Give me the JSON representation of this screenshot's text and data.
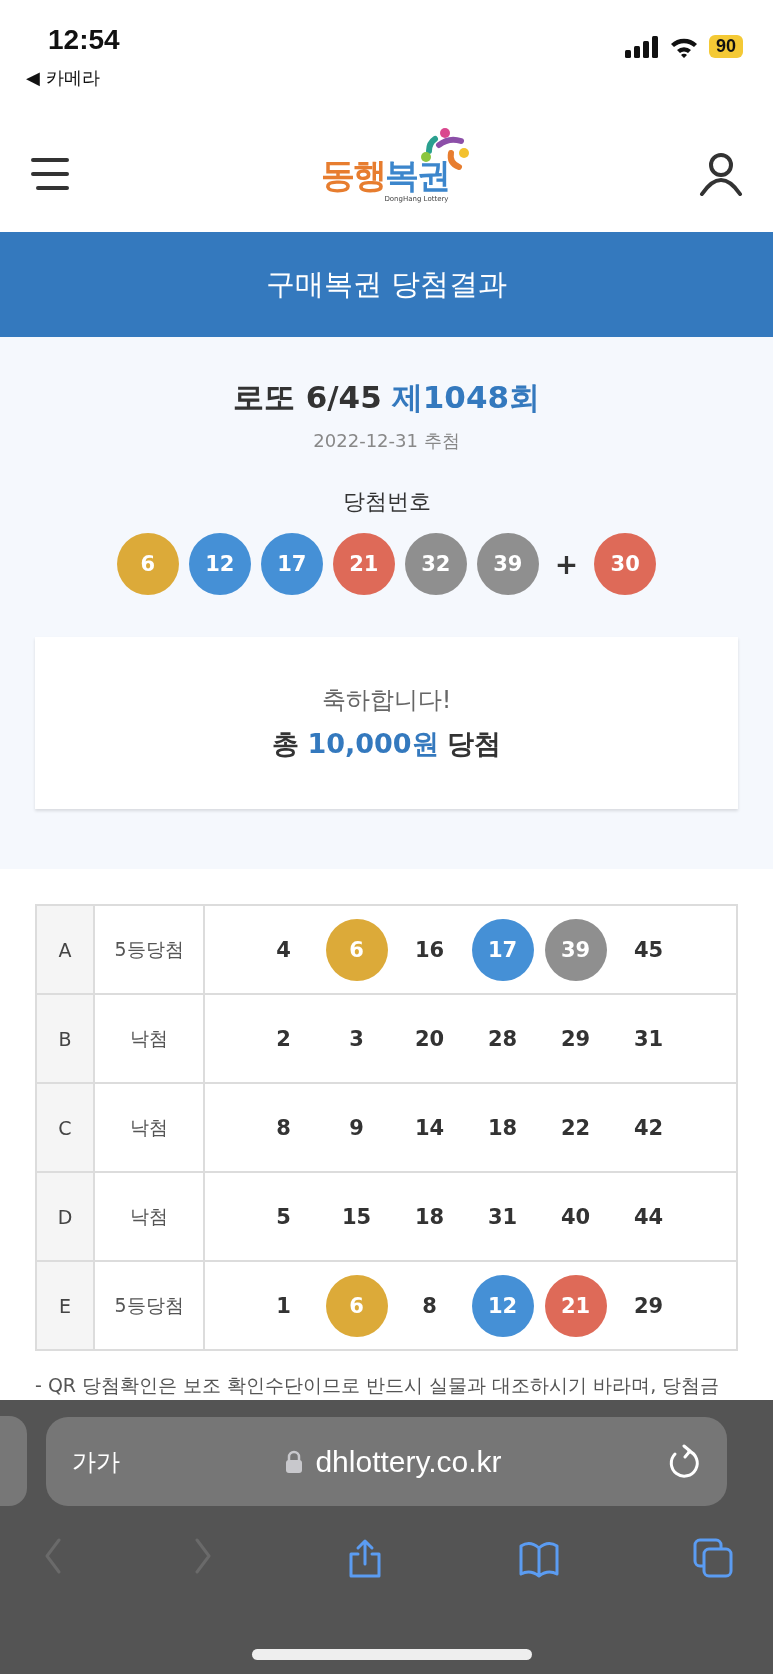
{
  "status_bar": {
    "time": "12:54",
    "back_app": "◀ 카메라",
    "battery": "90"
  },
  "header": {
    "logo": {
      "part_1": "동행",
      "part_2": "복권",
      "tagline": "DongHang Lottery"
    }
  },
  "banner": {
    "title": "구매복권 당첨결과"
  },
  "result": {
    "game": "로또 6/45",
    "round": "제1048회",
    "draw_date": "2022-12-31 추첨",
    "numbers_label": "당첨번호",
    "balls": [
      {
        "number": "6",
        "color": "#dcaa39"
      },
      {
        "number": "12",
        "color": "#4590d6"
      },
      {
        "number": "17",
        "color": "#4590d6"
      },
      {
        "number": "21",
        "color": "#de6a58"
      },
      {
        "number": "32",
        "color": "#8f8f8f"
      },
      {
        "number": "39",
        "color": "#8f8f8f"
      }
    ],
    "plus": "+",
    "bonus": {
      "number": "30",
      "color": "#de6a58"
    }
  },
  "prize_card": {
    "message": "축하합니다!",
    "prefix": "총",
    "amount": "10,000원",
    "suffix": "당첨"
  },
  "tickets": [
    {
      "line": "A",
      "status": "5등당첨",
      "numbers": [
        {
          "number": "4"
        },
        {
          "number": "6",
          "color": "#dcaa39"
        },
        {
          "number": "16"
        },
        {
          "number": "17",
          "color": "#4590d6"
        },
        {
          "number": "39",
          "color": "#8f8f8f"
        },
        {
          "number": "45"
        }
      ]
    },
    {
      "line": "B",
      "status": "낙첨",
      "numbers": [
        {
          "number": "2"
        },
        {
          "number": "3"
        },
        {
          "number": "20"
        },
        {
          "number": "28"
        },
        {
          "number": "29"
        },
        {
          "number": "31"
        }
      ]
    },
    {
      "line": "C",
      "status": "낙첨",
      "numbers": [
        {
          "number": "8"
        },
        {
          "number": "9"
        },
        {
          "number": "14"
        },
        {
          "number": "18"
        },
        {
          "number": "22"
        },
        {
          "number": "42"
        }
      ]
    },
    {
      "line": "D",
      "status": "낙첨",
      "numbers": [
        {
          "number": "5"
        },
        {
          "number": "15"
        },
        {
          "number": "18"
        },
        {
          "number": "31"
        },
        {
          "number": "40"
        },
        {
          "number": "44"
        }
      ]
    },
    {
      "line": "E",
      "status": "5등당첨",
      "numbers": [
        {
          "number": "1"
        },
        {
          "number": "6",
          "color": "#dcaa39"
        },
        {
          "number": "8"
        },
        {
          "number": "12",
          "color": "#4590d6"
        },
        {
          "number": "21",
          "color": "#de6a58"
        },
        {
          "number": "29"
        }
      ]
    }
  ],
  "note": "- QR 당첨확인은 보조 확인수단이므로 반드시 실물과 대조하시기 바라며, 당첨금",
  "browser": {
    "text_size": "가가",
    "url": "dhlottery.co.kr",
    "toolbar": [
      {
        "kind": "back",
        "disabled": true
      },
      {
        "kind": "forward",
        "disabled": true
      },
      {
        "kind": "share",
        "disabled": false
      },
      {
        "kind": "bookmarks",
        "disabled": false
      },
      {
        "kind": "tabs",
        "disabled": false
      }
    ]
  }
}
